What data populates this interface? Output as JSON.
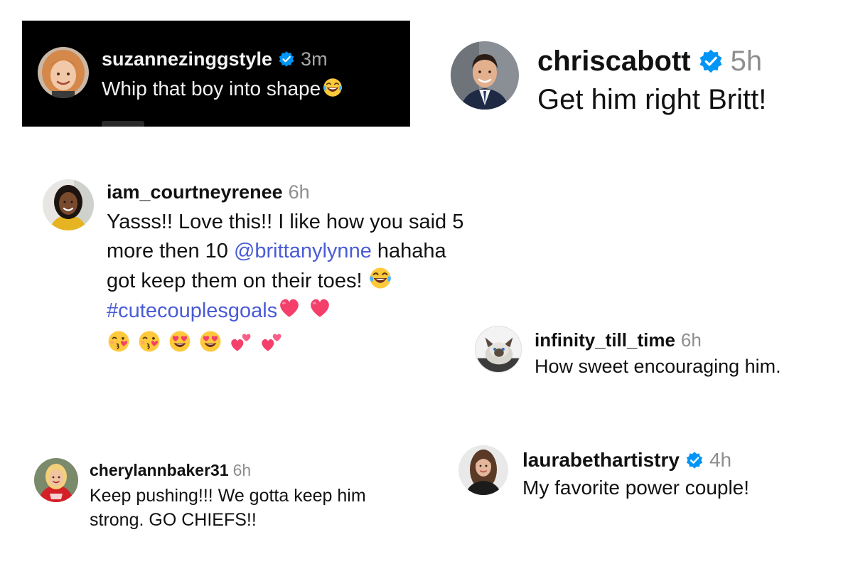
{
  "comments": [
    {
      "username": "suzannezinggstyle",
      "verified": true,
      "time": "3m",
      "text": "Whip that boy into shape",
      "emoji": "laughing-tears-icon",
      "theme": "dark"
    },
    {
      "username": "chriscabott",
      "verified": true,
      "time": "5h",
      "text": "Get him right Britt!"
    },
    {
      "username": "iam_courtneyrenee",
      "verified": false,
      "time": "6h",
      "text_part1": "Yasss!! Love this!! I like how you said 5 more then 10 ",
      "mention": "@brittanylynne",
      "text_part2": " hahaha got keep them on their toes! ",
      "hashtag": "#cutecouplesgoals",
      "emojis": [
        "laughing-tears-icon",
        "heart-icon",
        "heart-icon",
        "kissing-face-icon",
        "kissing-face-icon",
        "heart-eyes-icon",
        "heart-eyes-icon",
        "two-hearts-icon",
        "two-hearts-icon"
      ]
    },
    {
      "username": "infinity_till_time",
      "verified": false,
      "time": "6h",
      "text": "How sweet encouraging him."
    },
    {
      "username": "cherylannbaker31",
      "verified": false,
      "time": "6h",
      "text": "Keep pushing!!! We gotta keep him strong. GO CHIEFS!!"
    },
    {
      "username": "laurabethartistry",
      "verified": true,
      "time": "4h",
      "text": "My favorite power couple!"
    }
  ],
  "colors": {
    "link": "#4a5bd6",
    "verified": "#0095f6",
    "timestamp": "#8e8e8e",
    "dark_card_bg": "#000000"
  }
}
